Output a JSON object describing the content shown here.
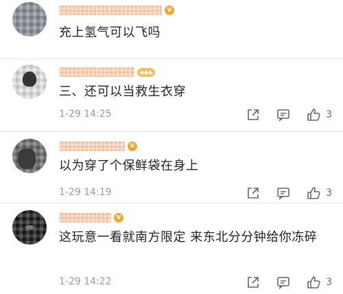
{
  "comments": [
    {
      "avatar_color": "#8a8f9a",
      "name_color": "#f08a3a",
      "name_hidden": true,
      "text": "充上氢气可以飞吗",
      "time": "",
      "likes": ""
    },
    {
      "avatar_color": "#d9d9d9",
      "name_color": "#f08a3a",
      "name_hidden": true,
      "text": "三、还可以当救生衣穿",
      "time": "1-29 14:25",
      "likes": "3"
    },
    {
      "avatar_color": "#6b6b6b",
      "name_color": "#f08a3a",
      "name_hidden": true,
      "text": "以为穿了个保鲜袋在身上",
      "time": "1-29 14:19",
      "likes": "3"
    },
    {
      "avatar_color": "#1a1a1a",
      "name_color": "#f08a3a",
      "name_hidden": true,
      "text": "这玩意一看就南方限定 来东北分分钟给你冻碎",
      "time": "1-29 14:22",
      "likes": "3"
    }
  ],
  "icons": {
    "share": "share-icon",
    "comment": "comment-icon",
    "like": "thumbs-up-icon",
    "vip": "vip-badge-icon"
  }
}
